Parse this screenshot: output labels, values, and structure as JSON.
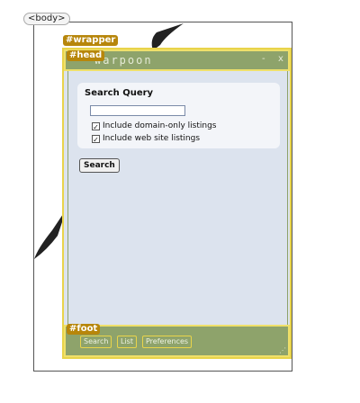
{
  "tags": {
    "body": "<body>",
    "wrapper": "#wrapper",
    "head": "#head",
    "foot": "#foot"
  },
  "header": {
    "title": "warpoon",
    "minimize": "-",
    "close": "x"
  },
  "query": {
    "label": "Search Query",
    "input_value": "",
    "options": [
      {
        "label": "Include domain-only listings",
        "checked": true
      },
      {
        "label": "Include web site listings",
        "checked": true
      }
    ],
    "check_glyph": "✓"
  },
  "search_button": "Search",
  "footer": {
    "buttons": [
      "Search",
      "List",
      "Preferences"
    ],
    "grip": "⋰"
  },
  "colors": {
    "header_green": "#8ea36b",
    "highlight_yellow": "#e9d44a",
    "panel_blue": "#dce3ee"
  }
}
